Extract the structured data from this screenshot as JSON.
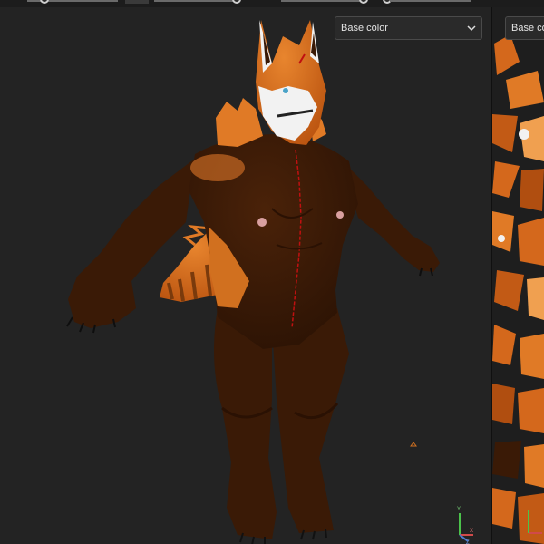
{
  "viewport": {
    "channel_select": {
      "value": "Base color"
    }
  },
  "uv_panel": {
    "channel_select": {
      "value": "Base color"
    }
  },
  "axis_gizmo": {
    "y_label": "Y",
    "x_label": "X",
    "z_label": "Z"
  },
  "colors": {
    "fur_orange": "#d4681c",
    "fur_dark_brown": "#3a1a06",
    "fur_white": "#f2f2f2",
    "background": "#232323",
    "seam_red": "#c01010"
  },
  "icons": [
    "chevron-down-icon",
    "axis-gizmo-icon",
    "light-marker-icon"
  ]
}
